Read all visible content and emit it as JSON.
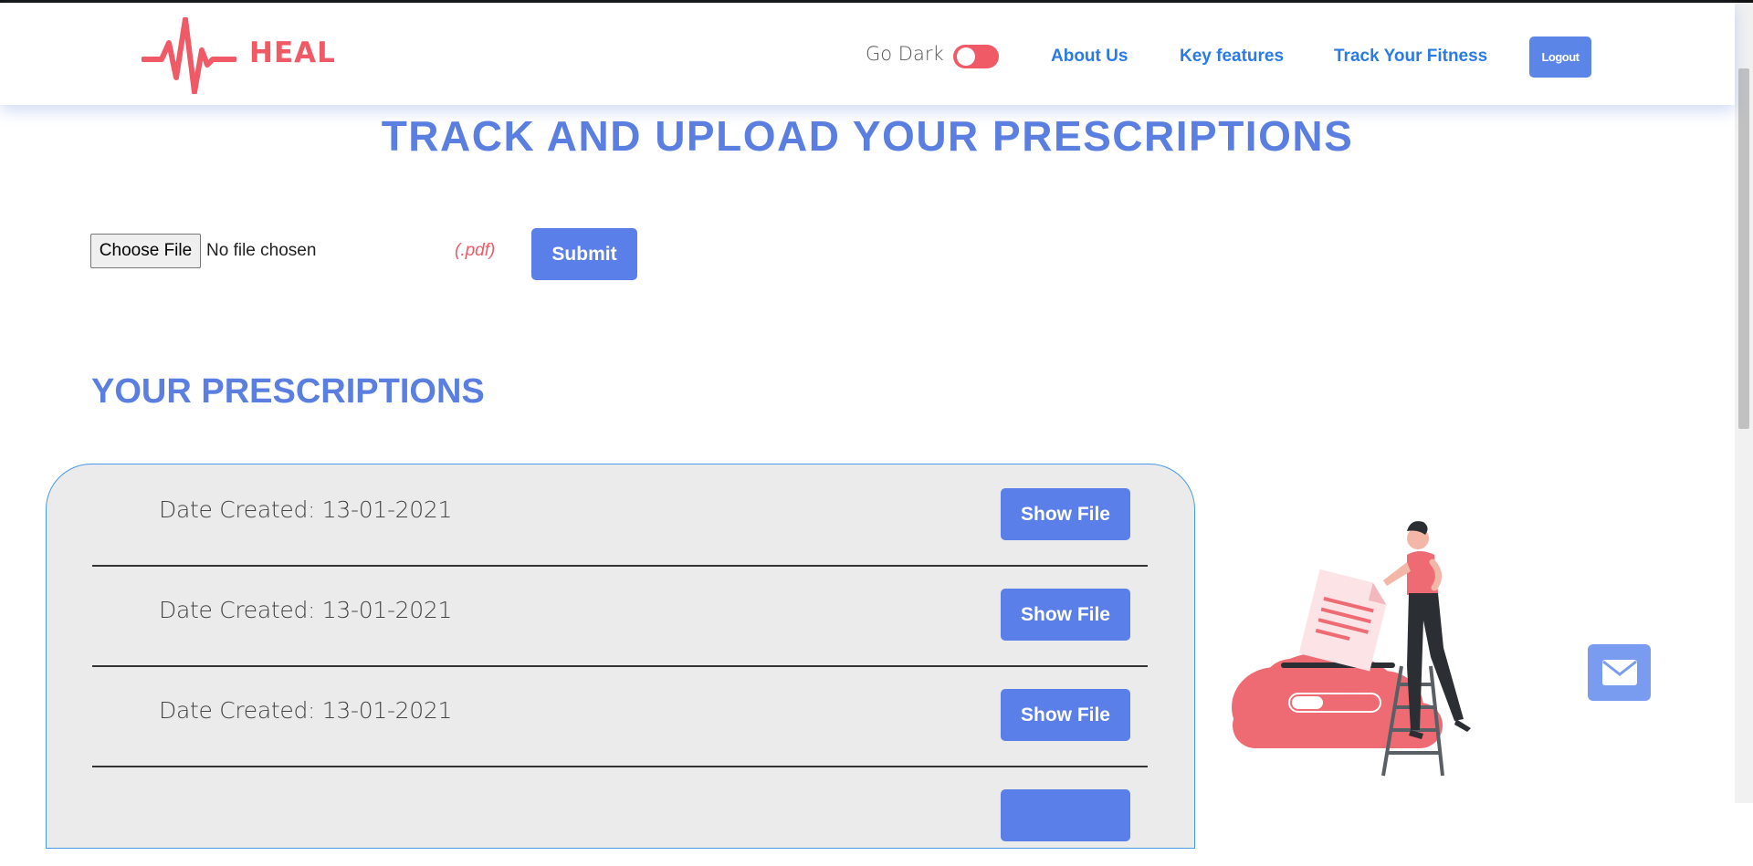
{
  "header": {
    "brand": "HEAL",
    "go_dark_label": "Go Dark",
    "nav": [
      {
        "label": "About Us"
      },
      {
        "label": "Key features"
      },
      {
        "label": "Track Your Fitness"
      }
    ],
    "logout_label": "Logout"
  },
  "main": {
    "title": "TRACK AND UPLOAD YOUR PRESCRIPTIONS",
    "upload": {
      "choose_file_label": "Choose File",
      "file_status": "No file chosen",
      "format_hint": "(.pdf)",
      "submit_label": "Submit"
    },
    "section_title": "YOUR PRESCRIPTIONS",
    "prescriptions": [
      {
        "date_text": "Date Created: 13-01-2021",
        "button": "Show File"
      },
      {
        "date_text": "Date Created: 13-01-2021",
        "button": "Show File"
      },
      {
        "date_text": "Date Created: 13-01-2021",
        "button": "Show File"
      },
      {
        "date_text": "",
        "button": ""
      }
    ]
  },
  "icons": {
    "logo": "heartbeat-icon",
    "fab": "envelope-icon"
  },
  "colors": {
    "brand_red": "#ef5a66",
    "primary_blue": "#5b7fe8",
    "link_blue": "#2a7be6"
  }
}
